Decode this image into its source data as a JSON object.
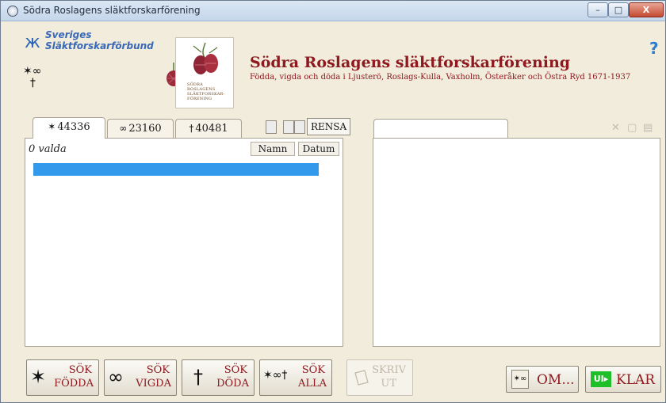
{
  "window": {
    "title": "Södra Roslagens släktforskarförening",
    "minimize_glyph": "–",
    "maximize_glyph": "□",
    "close_glyph": "X"
  },
  "header": {
    "federation_line1": "Sveriges",
    "federation_line2": "Släktforskarförbund",
    "assoc_logo_text": "SÖDRA ROSLAGENS SLÄKTFORSKAR-FÖRENING",
    "title": "Södra Roslagens släktforskarförening",
    "subtitle": "Födda, vigda och döda i Ljusterö, Roslags-Kulla, Vaxholm, Österåker och Östra Ryd 1671-1937",
    "help_glyph": "?"
  },
  "left_tabs": [
    {
      "symbol": "✶",
      "label": "44336"
    },
    {
      "symbol": "∞",
      "label": "23160"
    },
    {
      "symbol": "†",
      "label": "40481"
    }
  ],
  "left_toolbar": {
    "clear_label": "RENSA"
  },
  "results": {
    "count_label": "0 valda",
    "sort_name": "Namn",
    "sort_date": "Datum"
  },
  "right_toolbar": {
    "symbol_icon": "✕",
    "folder_icon": "▢",
    "doc_icon": "▤"
  },
  "bottom": {
    "search_born": {
      "icon": "✶",
      "top": "SÖK",
      "bottom": "FÖDDA"
    },
    "search_married": {
      "icon": "∞",
      "top": "SÖK",
      "bottom": "VIGDA"
    },
    "search_dead": {
      "icon": "†",
      "top": "SÖK",
      "bottom": "DÖDA"
    },
    "search_all": {
      "icon": "✶∞†",
      "top": "SÖK",
      "bottom": "ALLA"
    },
    "print": {
      "top": "SKRIV",
      "bottom": "UT"
    },
    "about": {
      "label": "OM..."
    },
    "exit": {
      "icon": "UI▸",
      "label": "KLAR"
    }
  },
  "colors": {
    "accent": "#8e1a20",
    "selection": "#3399ea",
    "help": "#2e7ccf",
    "exit": "#1fbf2a"
  }
}
